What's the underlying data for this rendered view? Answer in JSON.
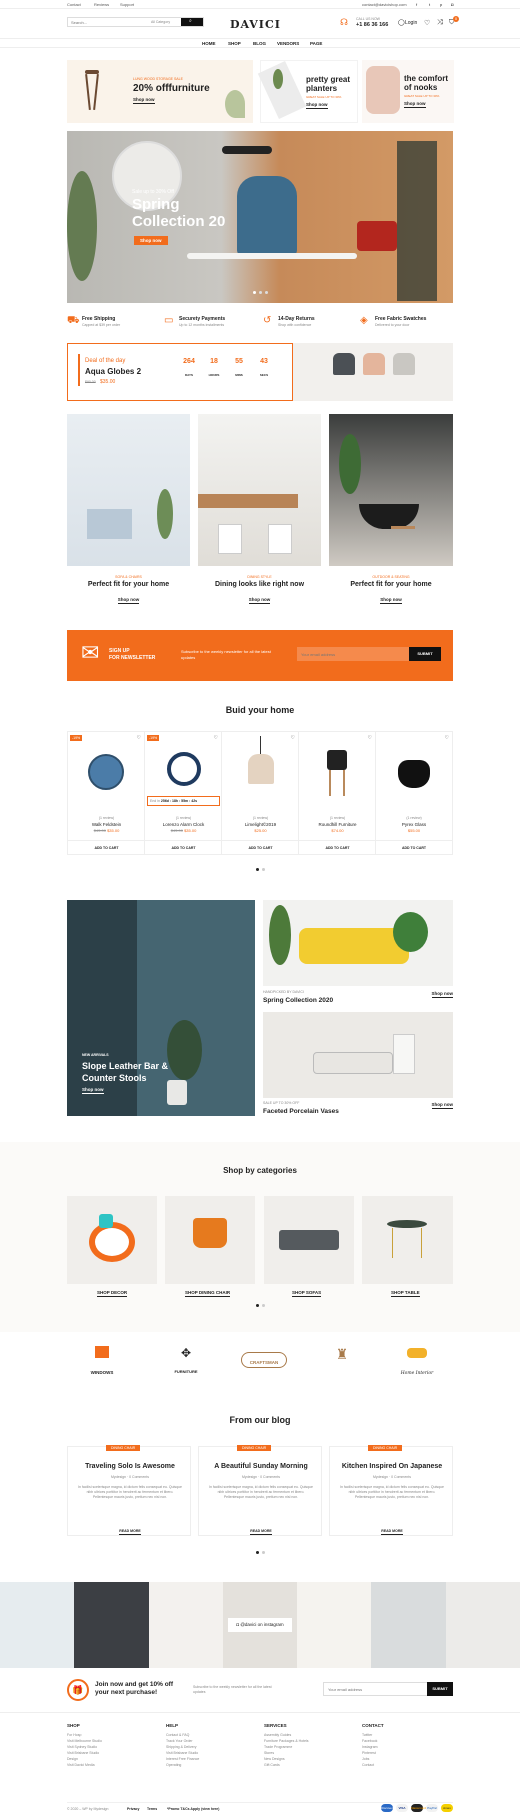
{
  "topbar": {
    "links": [
      "Contact",
      "Reviews",
      "Support"
    ],
    "email": "contact@davicishop.com",
    "socials": [
      "facebook-icon",
      "twitter-icon",
      "pinterest-icon",
      "instagram-icon"
    ]
  },
  "header": {
    "search_placeholder": "Search...",
    "category": "All Category",
    "logo": "DAVICI",
    "phone_label": "CALL US NOW",
    "phone": "+1 86 36 166",
    "login": "Login",
    "cart_count": "0"
  },
  "nav": [
    "HOME",
    "SHOP",
    "BLOG",
    "VENDORS",
    "PAGE"
  ],
  "promos": [
    {
      "kicker": "LUNG WOOD STORAGE SALE",
      "title": "20% offfurniture",
      "link": "Shop now"
    },
    {
      "title": "pretty great planters",
      "sub": "GREAT SALE UP TO 30%",
      "link": "Shop now"
    },
    {
      "title": "the comfort of nooks",
      "sub": "GREAT SALE UP TO 30%",
      "link": "Shop now"
    }
  ],
  "hero": {
    "kicker": "Sale up to 30% Off",
    "title1": "Spring",
    "title2": "Collection 20",
    "button": "Shop now"
  },
  "features": [
    {
      "icon": "truck-icon",
      "title": "Free Shipping",
      "sub": "Capped at $39 per order"
    },
    {
      "icon": "card-icon",
      "title": "Securety Payments",
      "sub": "Up to 12 months installments"
    },
    {
      "icon": "return-icon",
      "title": "14-Day Returns",
      "sub": "Shop with confidence"
    },
    {
      "icon": "swatch-icon",
      "title": "Free Fabric Swatches",
      "sub": "Delivered to your door"
    }
  ],
  "deal": {
    "label": "Deal of the day",
    "name": "Aqua Globes 2",
    "old": "$90.00",
    "price": "$35.00",
    "timer": [
      {
        "v": "264",
        "l": "DAYS"
      },
      {
        "v": "18",
        "l": "HOURS"
      },
      {
        "v": "55",
        "l": "MINS"
      },
      {
        "v": "43",
        "l": "SECS"
      }
    ]
  },
  "rooms": [
    {
      "kicker": "SOFA & CHAIRS",
      "title": "Perfect fit for your home",
      "link": "Shop now"
    },
    {
      "kicker": "DINING STYLE",
      "title": "Dining looks like right now",
      "link": "Shop now"
    },
    {
      "kicker": "OUTDOOR & SEATING",
      "title": "Perfect fit for your home",
      "link": "Shop now"
    }
  ],
  "newsletter": {
    "title1": "SIGN UP",
    "title2": "FOR NEWSLETTER",
    "text": "Subscribe to the weekly newsletter for all the latest updates",
    "placeholder": "Your email address",
    "button": "SUBMIT"
  },
  "build": {
    "title": "Buid your home",
    "products": [
      {
        "badge": "-19%",
        "name": "Walk Feldstein",
        "rating": "(1 review)",
        "old": "$43.00",
        "price": "$35.00",
        "cart": "ADD TO CART"
      },
      {
        "badge": "-19%",
        "name": "Lorenzo Alarm Clock",
        "rating": "(1 review)",
        "old": "$43.00",
        "price": "$35.00",
        "cart": "ADD TO CART",
        "countdown": "256d : 18h : 55m : 42s",
        "countdown_label": "End in"
      },
      {
        "badge": "",
        "name": "Limelight©2019",
        "rating": "(1 review)",
        "old": "",
        "price": "$25.00",
        "cart": "ADD TO CART"
      },
      {
        "badge": "",
        "name": "Roundhill Furniture",
        "rating": "(1 review)",
        "old": "",
        "price": "$74.00",
        "cart": "ADD TO CART"
      },
      {
        "badge": "",
        "name": "Pyrex Glass",
        "rating": "(1 review)",
        "old": "",
        "price": "$55.00",
        "cart": "ADD TO CART"
      }
    ]
  },
  "collections": {
    "big_kicker": "NEW ARRIVALS",
    "big_title": "Slope Leather Bar & Counter Stools",
    "big_link": "Shop now",
    "small": [
      {
        "kicker": "HANDPICKED BY DAVICI",
        "title": "Spring Collection 2020",
        "link": "Shop now"
      },
      {
        "kicker": "SALE UP TO 30% OFF",
        "title": "Faceted Porcelain Vases",
        "link": "Shop now"
      }
    ]
  },
  "categories": {
    "title": "Shop by categories",
    "items": [
      "SHOP DECOR",
      "SHOP DINING CHAIR",
      "SHOP SOFAS",
      "SHOP TABLE"
    ]
  },
  "brands": [
    "WINDOWS",
    "FURNITURE",
    "CRAFTSMAN",
    "",
    "Home Interior"
  ],
  "blog": {
    "title": "From our blog",
    "tag": "DINING CHAIR",
    "posts": [
      {
        "title": "Traveling Solo Is Awesome",
        "author": "Mydesign",
        "comments": "0 Comments",
        "excerpt": "In facilisi scelerisque magna, id dictum felis consequat eu. Quisque nibh ultrices porttitor in hendrerit ac fermentum et libero. Pellentesque mauris justo, pretium nec nisl non.",
        "more": "READ MORE"
      },
      {
        "title": "A Beautiful Sunday Morning",
        "author": "Mydesign",
        "comments": "0 Comments",
        "excerpt": "In facilisi scelerisque magna, id dictum felis consequat eu. Quisque nibh ultrices porttitor in hendrerit ac fermentum et libero. Pellentesque mauris justo, pretium nec nisl non.",
        "more": "READ MORE"
      },
      {
        "title": "Kitchen Inspired On Japanese",
        "author": "Mydesign",
        "comments": "0 Comments",
        "excerpt": "In facilisi scelerisque magna, id dictum felis consequat eu. Quisque nibh ultrices porttitor in hendrerit ac fermentum et libero. Pellentesque mauris justo, pretium nec nisl non.",
        "more": "READ MORE"
      }
    ]
  },
  "instagram": {
    "label": "@davici on instagram"
  },
  "join": {
    "title": "Join now and get 10% off your next purchase!",
    "text": "Subscribe to the weekly newsletter for all the latest updates",
    "placeholder": "Your email address",
    "button": "SUBMIT"
  },
  "footer": {
    "cols": [
      {
        "title": "SHOP",
        "items": [
          "For Hosp",
          "Visit Melbourne Studio",
          "Visit Sydney Studio",
          "Visit Brisbane Studio",
          "Design",
          "Visit Davici Media"
        ]
      },
      {
        "title": "HELP",
        "items": [
          "Contact & FAQ",
          "Track Your Order",
          "Shipping & Delivery",
          "Visit Brisbane Studio",
          "Interest Free Finance",
          "Operating"
        ]
      },
      {
        "title": "SERVICES",
        "items": [
          "Assembly Guides",
          "Furniture Packages & Hotels",
          "Trade Programme",
          "Stores",
          "New Designs",
          "Gift Cards"
        ]
      },
      {
        "title": "CONTACT",
        "items": [
          "Twitter",
          "Facebook",
          "Instagram",
          "Pinterest",
          "Jobs",
          "Contact"
        ]
      }
    ],
    "copyright": "© 2020 – WP by Mydesign",
    "links": [
      "Privacy",
      "Terms",
      "*Promo T&Cs Apply (view here)"
    ],
    "payments": [
      "Discover",
      "VISA",
      "Mastercard",
      "PayPal",
      "Amex"
    ]
  }
}
